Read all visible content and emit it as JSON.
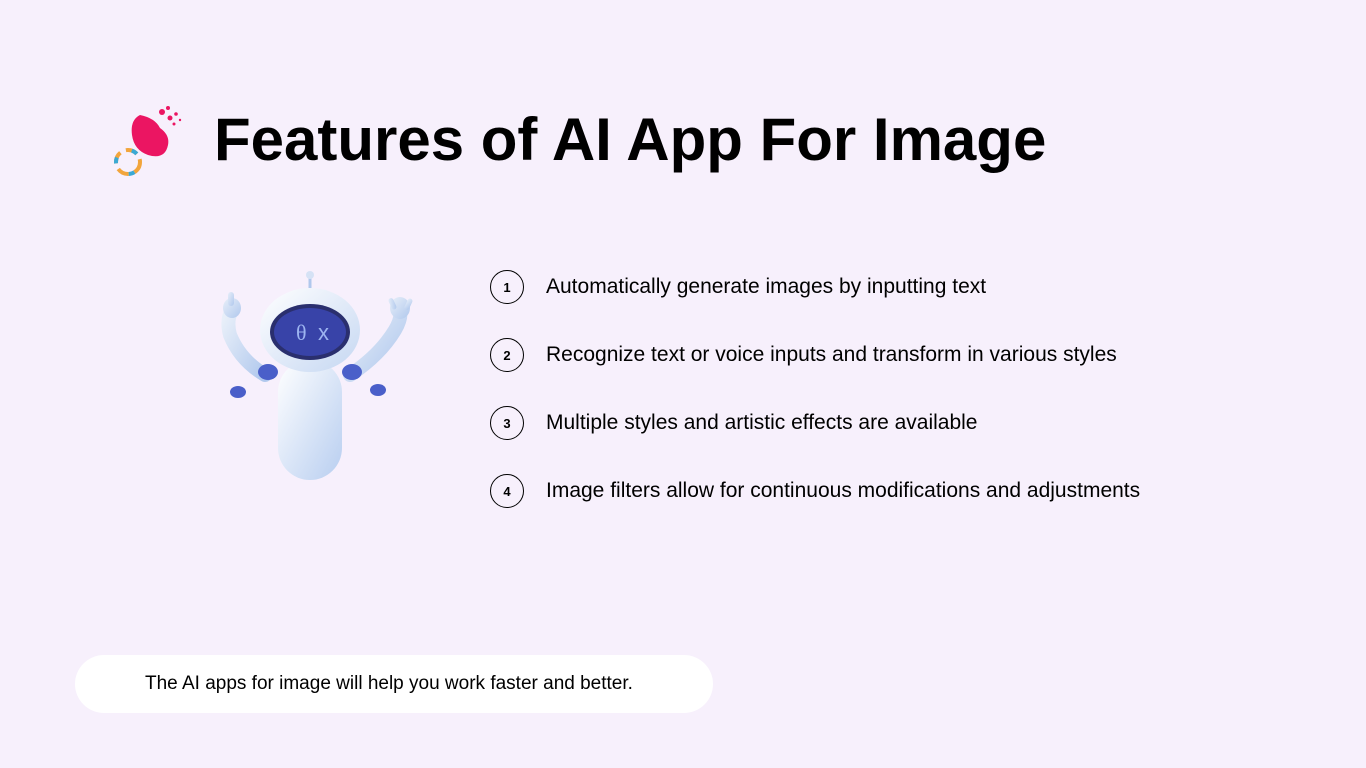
{
  "header": {
    "title": "Features of AI App For Image"
  },
  "features": [
    {
      "num": "1",
      "text": "Automatically generate images by inputting text"
    },
    {
      "num": "2",
      "text": "Recognize text or voice inputs and transform in various styles"
    },
    {
      "num": "3",
      "text": "Multiple styles and artistic effects are available"
    },
    {
      "num": "4",
      "text": "Image filters allow for continuous modifications and adjustments"
    }
  ],
  "footer": {
    "text": "The AI apps for image will help you work faster and better."
  }
}
